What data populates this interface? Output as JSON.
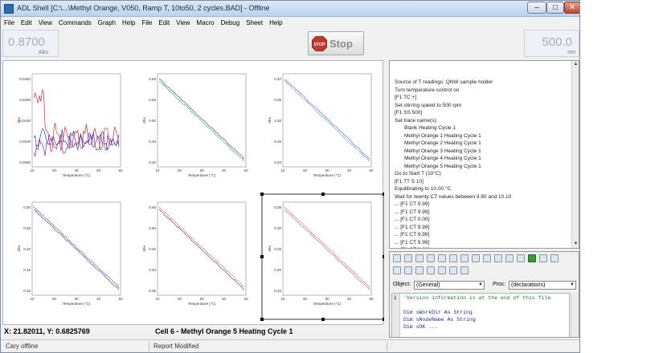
{
  "window": {
    "title": "ADL Shell [C:\\...\\Methyl Orange, V050, Ramp T, 10to50, 2 cycles.BAD] - Offline",
    "app_icon": "adl-shell-icon"
  },
  "menu": [
    "File",
    "Edit",
    "View",
    "Commands",
    "Graph",
    "Help",
    "File",
    "Edit",
    "View",
    "Macro",
    "Debug",
    "Sheet",
    "Help"
  ],
  "readouts": {
    "absorbance_value": "0.8700",
    "absorbance_unit": "Abs",
    "wavelength_value": "500.0",
    "wavelength_unit": "nm"
  },
  "stop_button": {
    "label": "Stop",
    "sign_text": "STOP"
  },
  "plots": {
    "xlabel": "Temperature (°C)",
    "ylabel": "Abs",
    "xticks": [
      "10",
      "20",
      "30",
      "40",
      "50"
    ],
    "panel_yticks": [
      [
        "0.0250",
        "0.0200",
        "0.0150",
        "0.0100",
        "0.0050"
      ],
      [
        "0.60",
        "0.55",
        "0.50",
        "0.45",
        "0.40"
      ],
      [
        "0.40",
        "0.35",
        "0.30",
        "0.25",
        "0.20"
      ],
      [
        "0.30",
        "0.25",
        "0.20",
        "0.15",
        "0.10"
      ],
      [
        "0.55",
        "0.50",
        "0.45",
        "0.40",
        "0.35"
      ],
      [
        "0.35",
        "0.30",
        "0.25",
        "0.20",
        "0.15"
      ]
    ],
    "colors": {
      "red": "#d62a2a",
      "blue": "#2b3fbf",
      "purple": "#8a2a9a",
      "green": "#2a9a5a",
      "cyan": "#19b5c9",
      "magenta": "#c02a8a",
      "orange": "#d8702a",
      "dark": "#2a3a7a",
      "violet": "#b24ad4"
    }
  },
  "coord_readout": "X: 21.82011, Y: 0.6825769",
  "cell_label": "Cell 6 - Methyl Orange 5 Heating Cycle 1",
  "log": {
    "lines": [
      {
        "text": "Source of T readings:  QNW sample holder",
        "indent": false
      },
      {
        "text": "Turn temperature control on",
        "indent": false
      },
      {
        "text": "[F1 TC +]",
        "indent": false
      },
      {
        "text": "Set stirring speed to 500 rpm",
        "indent": false
      },
      {
        "text": "[F1 SS 500]",
        "indent": false
      },
      {
        "text": "Set trace name(s).",
        "indent": false
      },
      {
        "text": "Blank Heating Cycle 1",
        "indent": true
      },
      {
        "text": "Methyl Orange 1 Heating Cycle 1",
        "indent": true
      },
      {
        "text": "Methyl Orange 2 Heating Cycle 1",
        "indent": true
      },
      {
        "text": "Methyl Orange 3 Heating Cycle 1",
        "indent": true
      },
      {
        "text": "Methyl Orange 4 Heating Cycle 1",
        "indent": true
      },
      {
        "text": "Methyl Orange 5 Heating Cycle 1",
        "indent": true
      },
      {
        "text": "Go to Start T (10°C)",
        "indent": false
      },
      {
        "text": "[F1 TT S 10]",
        "indent": false
      },
      {
        "text": "Equilibrating to 10.00 °C",
        "indent": false
      },
      {
        "text": "Wait for twenty CT values between 9.90 and 10.10",
        "indent": false
      },
      {
        "text": "... [F1 CT 9.99]",
        "indent": false
      },
      {
        "text": "... [F1 CT 9.99]",
        "indent": false
      },
      {
        "text": "... [F1 CT 0.00]",
        "indent": false
      },
      {
        "text": "... [F1 CT 9.99]",
        "indent": false
      },
      {
        "text": "... [F1 CT 9.99]",
        "indent": false
      },
      {
        "text": "... [F1 CT 9.99]",
        "indent": false
      },
      {
        "text": "... [F1 CT 9.99]",
        "indent": false
      },
      {
        "text": "... [F1 CT 9.99]",
        "indent": false
      },
      {
        "text": "... [F1 CT 9.99]",
        "indent": false
      }
    ]
  },
  "editor": {
    "object_label": "Object:",
    "object_value": "(General)",
    "proc_label": "Proc:",
    "proc_value": "(declarations)",
    "line_number": "1",
    "code_lines": [
      "'Version information is at the end of this file",
      "",
      "Dim sWorkDir As String",
      "Dim sNodeName As String",
      "Dim sOK ..."
    ]
  },
  "status": {
    "left": "Cary offline",
    "middle": "Report Modified"
  }
}
